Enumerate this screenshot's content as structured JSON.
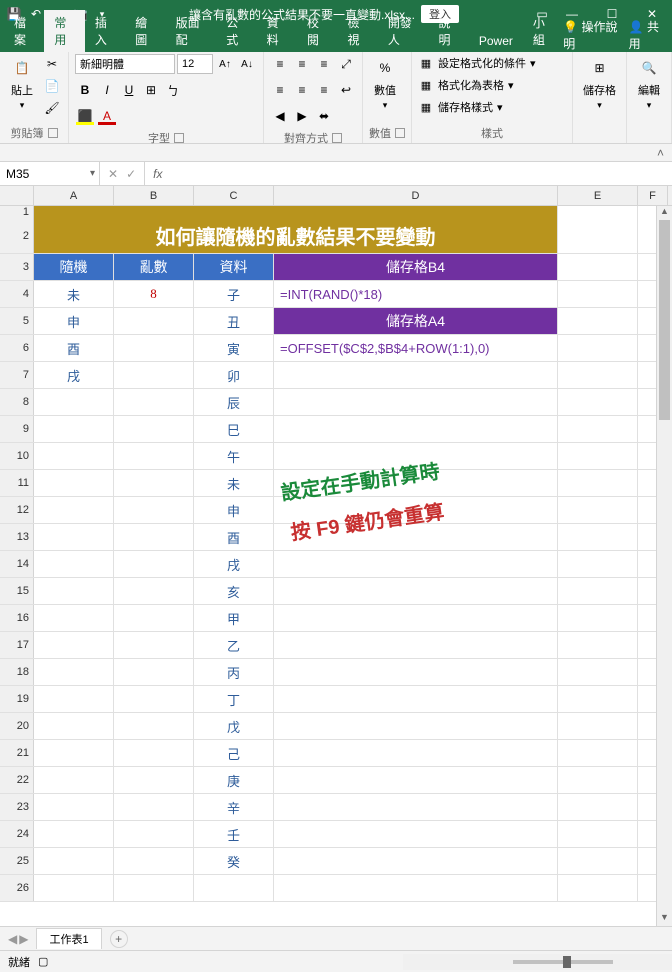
{
  "titlebar": {
    "filename": "讓含有亂數的公式結果不要一直變動.xlsx...",
    "login": "登入"
  },
  "tabs": {
    "file": "檔案",
    "home": "常用",
    "insert": "插入",
    "draw": "繪圖",
    "layout": "版面配",
    "formulas": "公式",
    "data": "資料",
    "review": "校閱",
    "view": "檢視",
    "developer": "開發人",
    "help": "說明",
    "power": "Power",
    "team": "小組",
    "tell_me": "操作說明",
    "share": "共用"
  },
  "ribbon": {
    "clipboard": {
      "paste": "貼上",
      "label": "剪貼簿"
    },
    "font": {
      "name": "新細明體",
      "size": "12",
      "label": "字型"
    },
    "align": {
      "label": "對齊方式"
    },
    "number": {
      "general": "",
      "label": "數值"
    },
    "styles": {
      "conditional": "設定格式化的條件",
      "table": "格式化為表格",
      "cellstyles": "儲存格樣式",
      "label": "樣式"
    },
    "cells": {
      "label": "儲存格"
    },
    "editing": {
      "label": "編輯"
    }
  },
  "namebox": "M35",
  "columns": [
    "A",
    "B",
    "C",
    "D",
    "E",
    "F"
  ],
  "rows": [
    "1",
    "2",
    "3",
    "4",
    "5",
    "6",
    "7",
    "8",
    "9",
    "10",
    "11",
    "12",
    "13",
    "14",
    "15",
    "16",
    "17",
    "18",
    "19",
    "20",
    "21",
    "22",
    "23",
    "24",
    "25",
    "26"
  ],
  "sheet": {
    "title": "如何讓隨機的亂數結果不要變動",
    "headers": {
      "random": "隨機",
      "num": "亂數",
      "data": "資料",
      "b4": "儲存格B4",
      "a4": "儲存格A4"
    },
    "colA": [
      "未",
      "申",
      "酉",
      "戌"
    ],
    "colB": "8",
    "colC": [
      "子",
      "丑",
      "寅",
      "卯",
      "辰",
      "巳",
      "午",
      "未",
      "申",
      "酉",
      "戌",
      "亥",
      "甲",
      "乙",
      "丙",
      "丁",
      "戊",
      "己",
      "庚",
      "辛",
      "壬",
      "癸"
    ],
    "formulaB4": "=INT(RAND()*18)",
    "formulaA4": "=OFFSET($C$2,$B$4+ROW(1:1),0)",
    "anno1": "設定在手動計算時",
    "anno2": "按 F9 鍵仍會重算"
  },
  "sheetTab": "工作表1",
  "status": {
    "ready": "就緒",
    "zoom": "100%"
  }
}
